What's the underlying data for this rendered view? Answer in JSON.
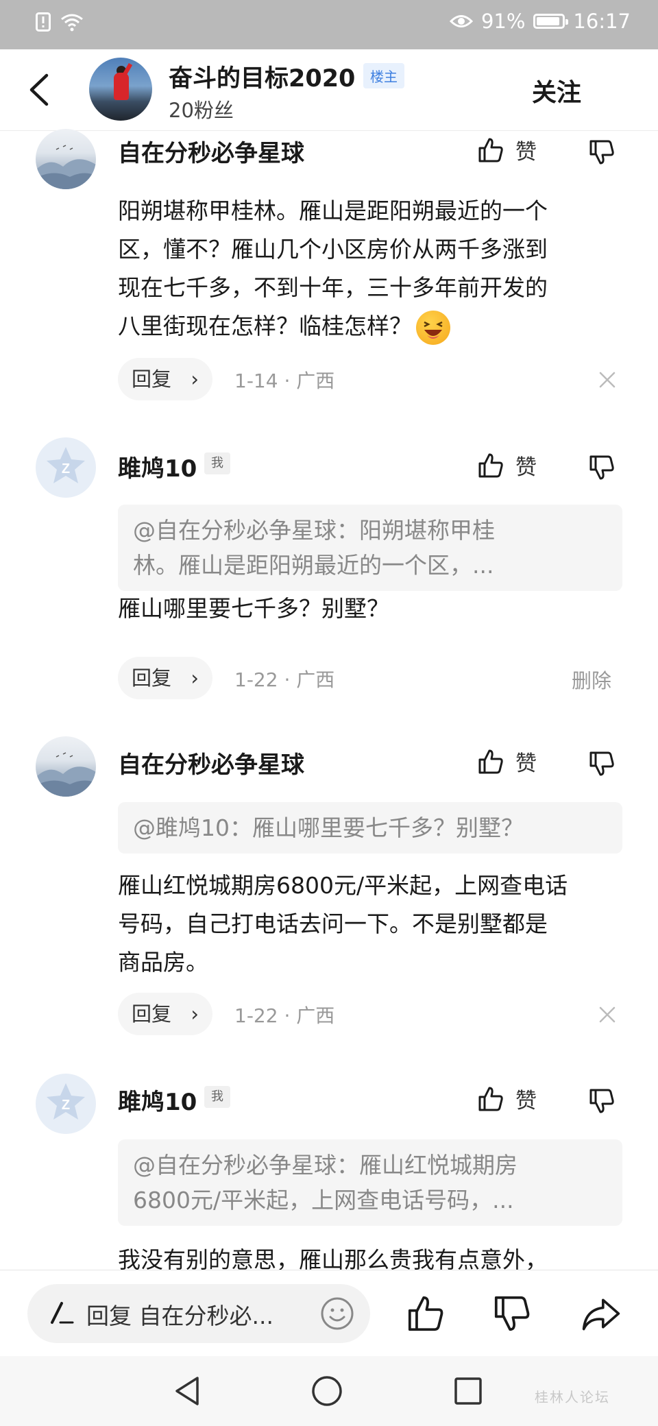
{
  "status_bar": {
    "battery": "91%",
    "time": "16:17",
    "battery_level": 0.91
  },
  "header": {
    "owner_name": "奋斗的目标2020",
    "owner_tag": "楼主",
    "fans": "20粉丝",
    "follow_label": "关注"
  },
  "comments": [
    {
      "username": "自在分秒必争星球",
      "like_label": "赞",
      "text_lines": [
        "阳朔堪称甲桂林。雁山是距阳朔最近的一个",
        "区，懂不？雁山几个小区房价从两千多涨到",
        "现在七千多，不到十年，三十多年前开发的",
        "八里街现在怎样？临桂怎样？"
      ],
      "reply_label": "回复",
      "meta": "1-14 · 广西"
    },
    {
      "username": "雎鸠10",
      "me_tag": "我",
      "like_label": "赞",
      "quote_lines": [
        "@自在分秒必争星球：阳朔堪称甲桂",
        "林。雁山是距阳朔最近的一个区，..."
      ],
      "text": "雁山哪里要七千多？别墅？",
      "reply_label": "回复",
      "meta": "1-22 · 广西",
      "delete_label": "删除"
    },
    {
      "username": "自在分秒必争星球",
      "like_label": "赞",
      "quote": "@雎鸠10：雁山哪里要七千多？别墅？",
      "text_lines": [
        "雁山红悦城期房6800元/平米起，上网查电话",
        "号码，自己打电话去问一下。不是别墅都是",
        "商品房。"
      ],
      "reply_label": "回复",
      "meta": "1-22 · 广西"
    },
    {
      "username": "雎鸠10",
      "me_tag": "我",
      "like_label": "赞",
      "quote_lines": [
        "@自在分秒必争星球：雁山红悦城期房",
        "6800元/平米起，上网查电话号码，..."
      ],
      "text": "我没有别的意思，雁山那么贵我有点意外，"
    }
  ],
  "bottom_bar": {
    "input_text": "回复 自在分秒必..."
  },
  "nav_bar": {
    "watermark": "桂林人论坛"
  }
}
